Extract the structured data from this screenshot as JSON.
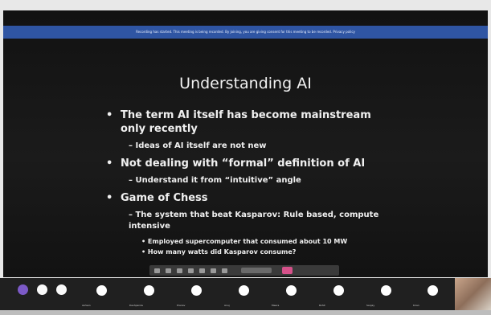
{
  "banner": {
    "text": "Recording has started. This meeting is being recorded. By joining, you are giving consent for this meeting to be recorded. Privacy policy"
  },
  "slide": {
    "title": "Understanding AI",
    "bullets": [
      {
        "text": "The term AI itself has become mainstream only recently",
        "subs": [
          {
            "text": "Ideas of AI itself are not new",
            "subs": []
          }
        ]
      },
      {
        "text": "Not dealing with “formal” definition of AI",
        "subs": [
          {
            "text": "Understand it from “intuitive” angle",
            "subs": []
          }
        ]
      },
      {
        "text": "Game of Chess",
        "subs": [
          {
            "text": "The system that beat Kasparov: Rule based, compute intensive",
            "subs": [
              "Employed supercomputer that consumed about 10 MW",
              "How many watts did Kasparov consume?"
            ]
          }
        ]
      }
    ]
  },
  "participants": [
    {
      "name": "Ashwin"
    },
    {
      "name": "Deshpande"
    },
    {
      "name": "Pranav"
    },
    {
      "name": "Anuj"
    },
    {
      "name": "Meera"
    },
    {
      "name": "Rohit"
    },
    {
      "name": "Sanjay"
    },
    {
      "name": "Kiran"
    }
  ],
  "colors": {
    "banner": "#2f55a3",
    "stop": "#d6518a",
    "accent": "#7c5ac7"
  }
}
